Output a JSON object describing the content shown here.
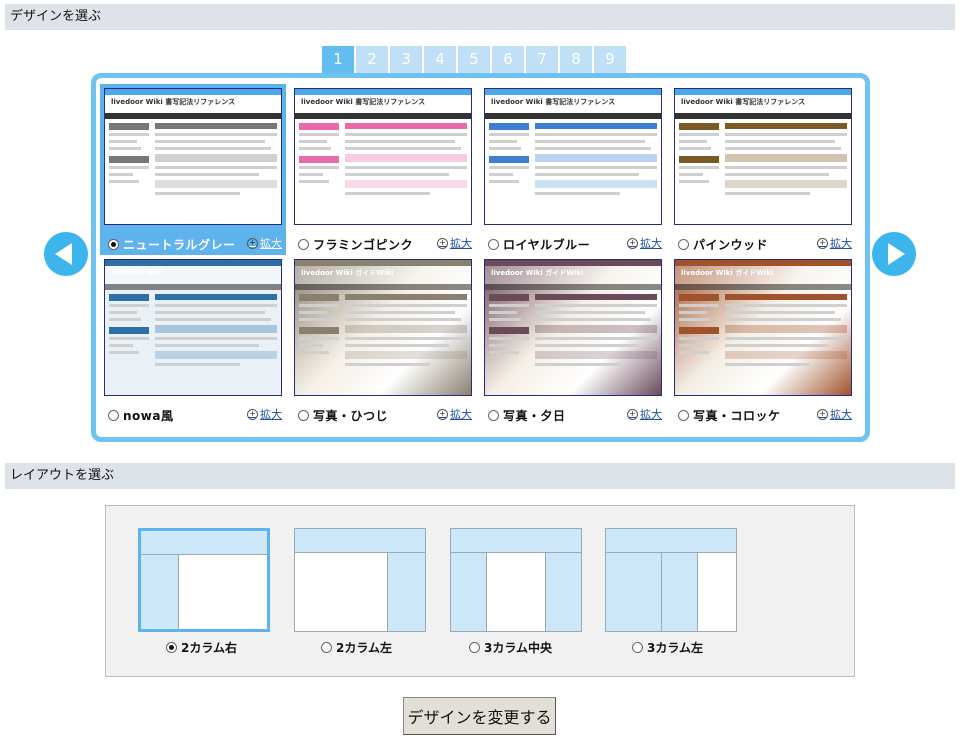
{
  "design_section": {
    "title": "デザインを選ぶ"
  },
  "layout_section": {
    "title": "レイアウトを選ぶ"
  },
  "pagination": [
    "1",
    "2",
    "3",
    "4",
    "5",
    "6",
    "7",
    "8",
    "9"
  ],
  "pagination_active": "1",
  "themes": [
    {
      "label": "ニュートラルグレー",
      "zoom": "拡大",
      "thumb_title": "livedoor Wiki 書写記法リファレンス",
      "accent": "#777777",
      "selected": true
    },
    {
      "label": "フラミンゴピンク",
      "zoom": "拡大",
      "thumb_title": "livedoor Wiki 書写記法リファレンス",
      "accent": "#e86aa8",
      "selected": false
    },
    {
      "label": "ロイヤルブルー",
      "zoom": "拡大",
      "thumb_title": "livedoor Wiki 書写記法リファレンス",
      "accent": "#3f7fd1",
      "selected": false
    },
    {
      "label": "パインウッド",
      "zoom": "拡大",
      "thumb_title": "livedoor Wiki 書写記法リファレンス",
      "accent": "#7a5a22",
      "selected": false
    },
    {
      "label": "nowa風",
      "zoom": "拡大",
      "thumb_title": "livedoor Wiki",
      "accent": "#2f6fa8",
      "selected": false
    },
    {
      "label": "写真・ひつじ",
      "zoom": "拡大",
      "thumb_title": "livedoor Wiki ガイドWiki",
      "accent": "#8a8070",
      "selected": false
    },
    {
      "label": "写真・夕日",
      "zoom": "拡大",
      "thumb_title": "livedoor Wiki ガイドWiki",
      "accent": "#6b4a5a",
      "selected": false
    },
    {
      "label": "写真・コロッケ",
      "zoom": "拡大",
      "thumb_title": "livedoor Wiki ガイドWiki",
      "accent": "#a0522d",
      "selected": false
    }
  ],
  "layouts": [
    {
      "label": "2カラム右",
      "selected": true
    },
    {
      "label": "2カラム左",
      "selected": false
    },
    {
      "label": "3カラム中央",
      "selected": false
    },
    {
      "label": "3カラム左",
      "selected": false
    }
  ],
  "submit_label": "デザインを変更する"
}
